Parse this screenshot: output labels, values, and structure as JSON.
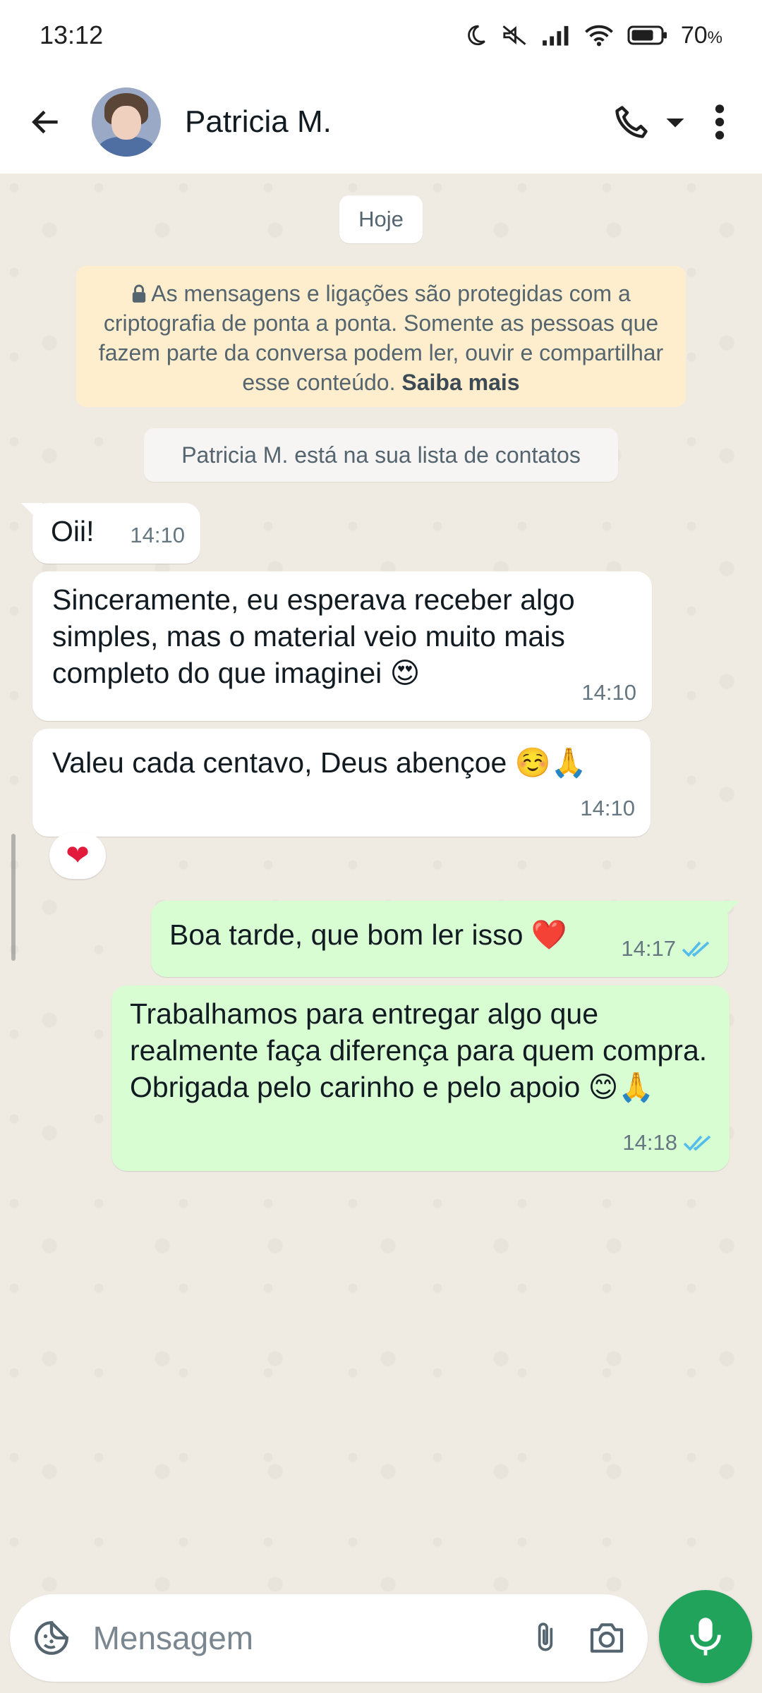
{
  "status_bar": {
    "time": "13:12",
    "battery_percent": "70",
    "battery_suffix": "%",
    "icons": [
      "moon-icon",
      "mute-icon",
      "signal-icon",
      "wifi-icon",
      "battery-icon"
    ]
  },
  "header": {
    "contact_name": "Patricia M.",
    "icons": [
      "back-arrow-icon",
      "phone-icon",
      "dropdown-caret-icon",
      "more-vert-icon"
    ]
  },
  "chat": {
    "date_chip": "Hoje",
    "e2e_notice": {
      "text": "As mensagens e ligações são protegidas com a criptografia de ponta a ponta. Somente as pessoas que fazem parte da conversa podem ler, ouvir e compartilhar esse conteúdo.",
      "learn_more": "Saiba mais"
    },
    "contact_notice": "Patricia M. está na sua lista de contatos",
    "messages": [
      {
        "direction": "in",
        "text": "Oii!",
        "time": "14:10"
      },
      {
        "direction": "in",
        "text": "Sinceramente, eu esperava receber algo simples, mas o material veio muito mais completo do que imaginei 😍",
        "time": "14:10"
      },
      {
        "direction": "in",
        "text": "Valeu cada centavo, Deus abençoe ☺️🙏",
        "time": "14:10",
        "reaction": "❤"
      },
      {
        "direction": "out",
        "text": "Boa tarde, que bom ler isso ❤️",
        "time": "14:17",
        "status": "read"
      },
      {
        "direction": "out",
        "text": "Trabalhamos para entregar algo que realmente faça diferença para quem compra. Obrigada pelo carinho e pelo apoio 😊🙏",
        "time": "14:18",
        "status": "read"
      }
    ]
  },
  "composer": {
    "placeholder": "Mensagem",
    "icons": [
      "sticker-icon",
      "attachment-icon",
      "camera-icon",
      "microphone-icon"
    ]
  },
  "colors": {
    "chat_bg": "#efeae2",
    "incoming_bubble": "#ffffff",
    "outgoing_bubble": "#d9fdd3",
    "encryption_notice_bg": "#ffeecd",
    "read_ticks": "#53bdeb",
    "mic_button": "#21a35b"
  }
}
